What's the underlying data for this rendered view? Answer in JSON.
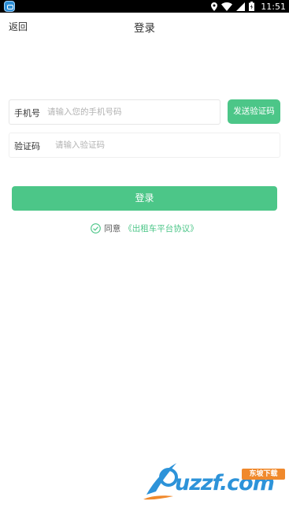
{
  "status_bar": {
    "time": "11:51",
    "icons": [
      "app-icon",
      "location-icon",
      "wifi-icon",
      "signal-icon",
      "battery-icon"
    ]
  },
  "header": {
    "back_label": "返回",
    "title": "登录"
  },
  "form": {
    "phone": {
      "label": "手机号",
      "placeholder": "请输入您的手机号码",
      "value": ""
    },
    "code": {
      "label": "验证码",
      "placeholder": "请输入验证码",
      "value": ""
    },
    "send_code_label": "发送验证码",
    "login_label": "登录"
  },
  "agreement": {
    "checked": true,
    "prefix": "同意",
    "link_text": "《出租车平台协议》"
  },
  "watermark": {
    "text": "uzzf.com",
    "badge": "东坡下载"
  },
  "colors": {
    "accent": "#4cc688",
    "text": "#333333",
    "placeholder": "#b3b3b3",
    "status_bar": "#000000"
  }
}
